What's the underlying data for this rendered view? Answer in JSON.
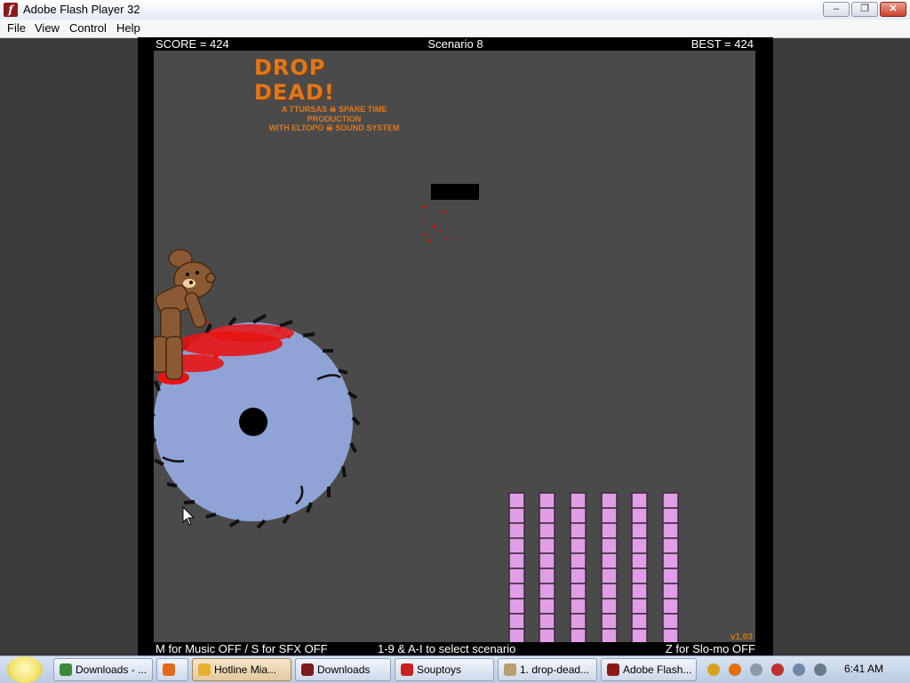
{
  "window": {
    "title": "Adobe Flash Player 32",
    "app_icon_glyph": "f",
    "buttons": {
      "minimize": "–",
      "maximize": "❐",
      "close": "✕"
    }
  },
  "menu": [
    "File",
    "View",
    "Control",
    "Help"
  ],
  "game": {
    "score": "SCORE = 424",
    "scenario": "Scenario 8",
    "best": "BEST = 424",
    "logo_title": "DROP DEAD!",
    "logo_line1": "A TTURSAS ☠ SPARE TIME PRODUCTION",
    "logo_line2": "WITH ELTOPO ☠ SOUND SYSTEM",
    "controls_left": "M for Music OFF / S for SFX OFF",
    "controls_center": "1-9 & A-I to select scenario",
    "controls_right": "Z for Slo-mo OFF",
    "version": "v1.03",
    "colors": {
      "saw": "#8fa3d6",
      "blocks": "#e09ee6",
      "blood": "#e81414",
      "bear": "#8b5a34",
      "logo": "#e0781a"
    }
  },
  "taskbar": {
    "items": [
      {
        "label": "Downloads - ...",
        "icon_color": "#3a8a3a"
      },
      {
        "label": "",
        "icon_color": "#e06a1a"
      },
      {
        "label": "Hotline Mia...",
        "icon_color": "#e8b030",
        "active": true
      },
      {
        "label": "Downloads",
        "icon_color": "#7a1a1a"
      },
      {
        "label": "Souptoys",
        "icon_color": "#c82020"
      },
      {
        "label": "1. drop-dead...",
        "icon_color": "#b8a070"
      },
      {
        "label": "Adobe Flash...",
        "icon_color": "#8a1a1a"
      }
    ],
    "clock": "6:41 AM"
  }
}
